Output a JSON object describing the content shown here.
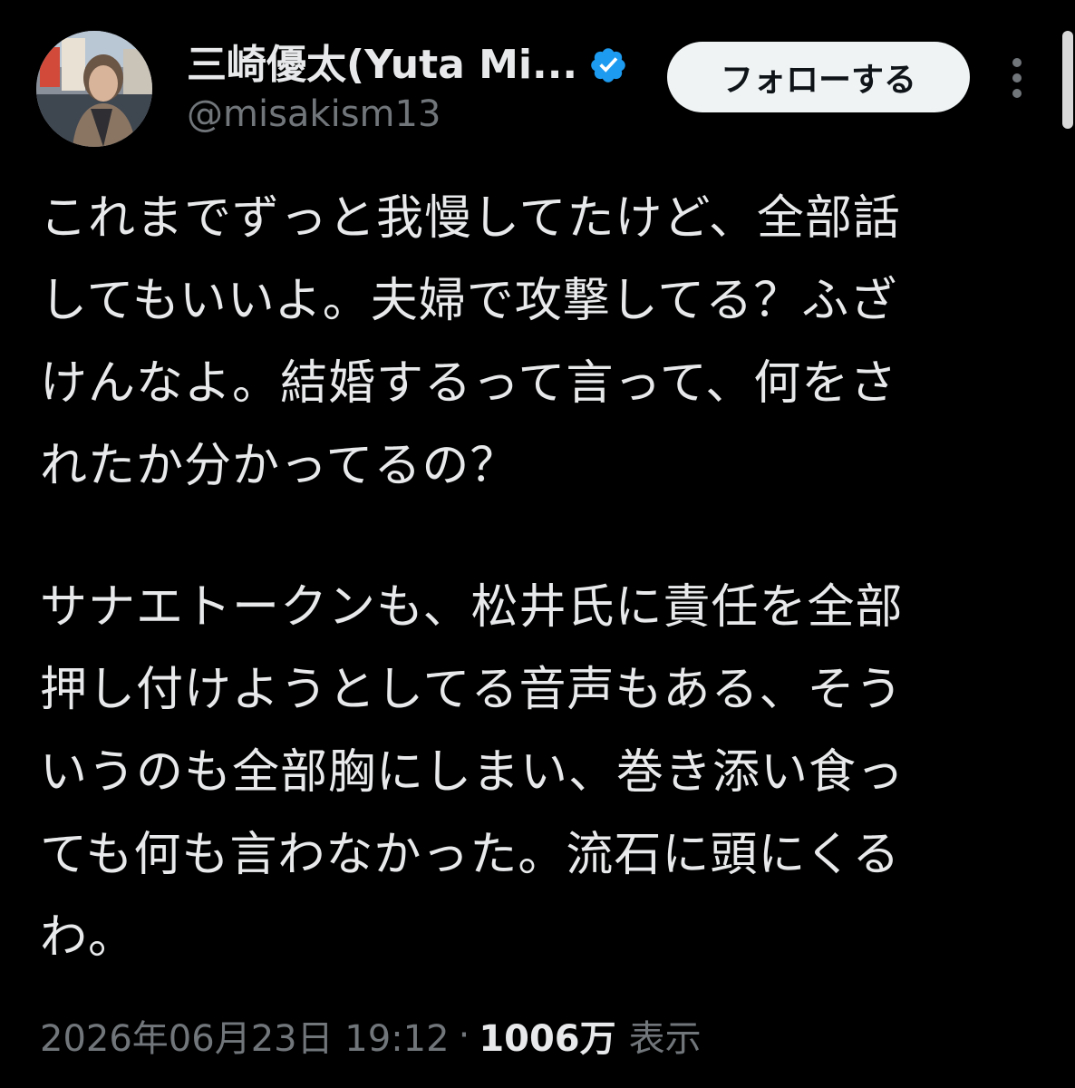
{
  "author": {
    "display_name": "三崎優太(Yuta Mi...",
    "handle": "@misakism13",
    "verified": true,
    "avatar_icon": "profile-photo",
    "badge_color": "#1d9bf0"
  },
  "header": {
    "follow_label": "フォローする",
    "more_icon": "more-vertical-icon"
  },
  "tweet": {
    "lines": [
      "これまでずっと我慢してたけど、全部話",
      "してもいいよ。夫婦で攻撃してる？ふざ",
      "けんなよ。結婚するって言って、何をさ",
      "れたか分かってるの？",
      "",
      "サナエトークンも、松井氏に責任を全部",
      "押し付けようとしてる音声もある、そう",
      "いうのも全部胸にしまい、巻き添い食っ",
      "ても何も言わなかった。流石に頭にくる",
      "わ。"
    ]
  },
  "meta": {
    "timestamp": "2026年06月23日 19:12",
    "separator": "·",
    "view_count": "1006万",
    "view_label": "表示"
  },
  "colors": {
    "background": "#000000",
    "text_primary": "#e7e9ea",
    "text_secondary": "#71767b",
    "follow_bg": "#eff3f4"
  }
}
